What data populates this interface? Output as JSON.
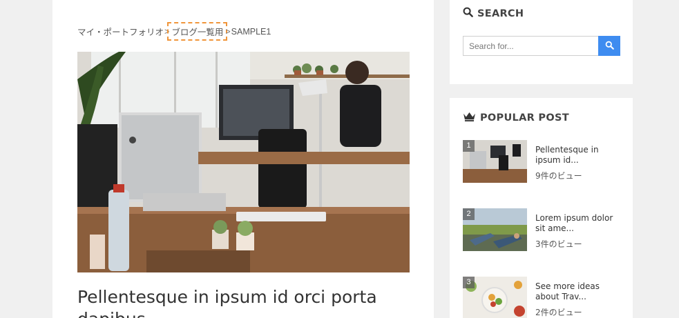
{
  "breadcrumb": {
    "items": [
      "マイ・ポートフォリオ",
      "ブログ一覧用",
      "SAMPLE1"
    ],
    "separator": ">"
  },
  "post": {
    "image_alt": "office-desk-photo",
    "title": "Pellentesque in ipsum id orci porta dapibus"
  },
  "sidebar": {
    "search": {
      "title": "SEARCH",
      "placeholder": "Search for...",
      "icon": "search-icon",
      "button_color": "#3e8cf0"
    },
    "popular": {
      "title": "POPULAR POST",
      "icon": "crown-icon",
      "items": [
        {
          "rank": "1",
          "title": "Pellentesque in ipsum id...",
          "views": "9件のビュー"
        },
        {
          "rank": "2",
          "title": "Lorem ipsum dolor sit ame...",
          "views": "3件のビュー"
        },
        {
          "rank": "3",
          "title": "See more ideas about Trav...",
          "views": "2件のビュー"
        }
      ]
    }
  },
  "colors": {
    "accent": "#3e8cf0",
    "highlight_outline": "#f0953a",
    "background": "#f0f0f0"
  }
}
